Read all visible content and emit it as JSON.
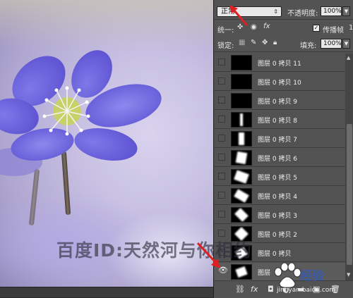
{
  "options": {
    "blend_mode": "正常",
    "opacity_label": "不透明度:",
    "opacity_value": "100%",
    "unify_label": "统一:",
    "propagate_frame_label": "传播帧",
    "propagate_frame_suffix": "1",
    "lock_label": "锁定:",
    "fill_label": "填充:",
    "fill_value": "100%"
  },
  "layers": [
    {
      "name": "图层 0 拷贝 11",
      "visible": false
    },
    {
      "name": "图层 0 拷贝 10",
      "visible": false
    },
    {
      "name": "图层 0 拷贝 9",
      "visible": false
    },
    {
      "name": "图层 0 拷贝 8",
      "visible": false
    },
    {
      "name": "图层 0 拷贝 7",
      "visible": false
    },
    {
      "name": "图层 0 拷贝 6",
      "visible": false
    },
    {
      "name": "图层 0 拷贝 5",
      "visible": false
    },
    {
      "name": "图层 0 拷贝 4",
      "visible": false
    },
    {
      "name": "图层 0 拷贝 3",
      "visible": false
    },
    {
      "name": "图层 0 拷贝 2",
      "visible": false
    },
    {
      "name": "图层 0 拷贝",
      "visible": false
    },
    {
      "name": "图层",
      "visible": true
    }
  ],
  "watermark": "百度ID:天然河与你相约",
  "logo": {
    "text": "经验",
    "url": "jingyan.baidu.com"
  },
  "colors": {
    "arrow": "#e02020",
    "panel": "#535353",
    "logo_blue": "#3a5aa8"
  }
}
